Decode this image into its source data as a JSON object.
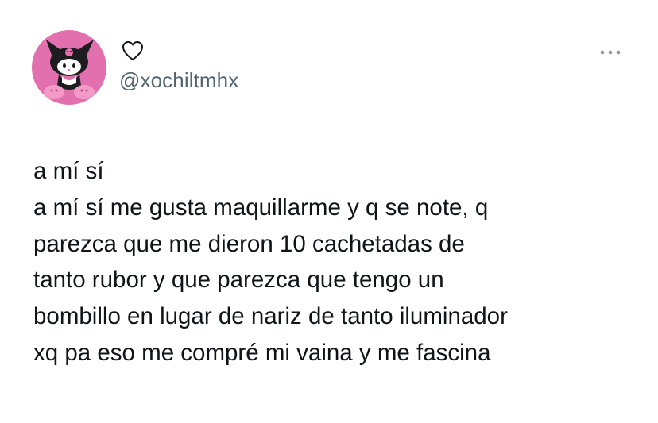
{
  "profile": {
    "handle": "@xochiltmhx",
    "avatar_icon": "kuromi-avatar",
    "avatar_bg": "#e26fae"
  },
  "actions": {
    "like_icon": "heart-outline-icon",
    "more_icon": "more-options-icon"
  },
  "tweet": {
    "lines": [
      "a mí sí",
      "a mí sí me gusta maquillarme y q se note, q",
      "parezca que me dieron 10 cachetadas de",
      "tanto rubor y que parezca que tengo un",
      "bombillo en lugar de nariz de tanto iluminador",
      "xq pa eso me compré mi vaina y me fascina"
    ]
  },
  "colors": {
    "text": "#0f1419",
    "secondary": "#536471",
    "icon_gray": "#8b98a5"
  }
}
